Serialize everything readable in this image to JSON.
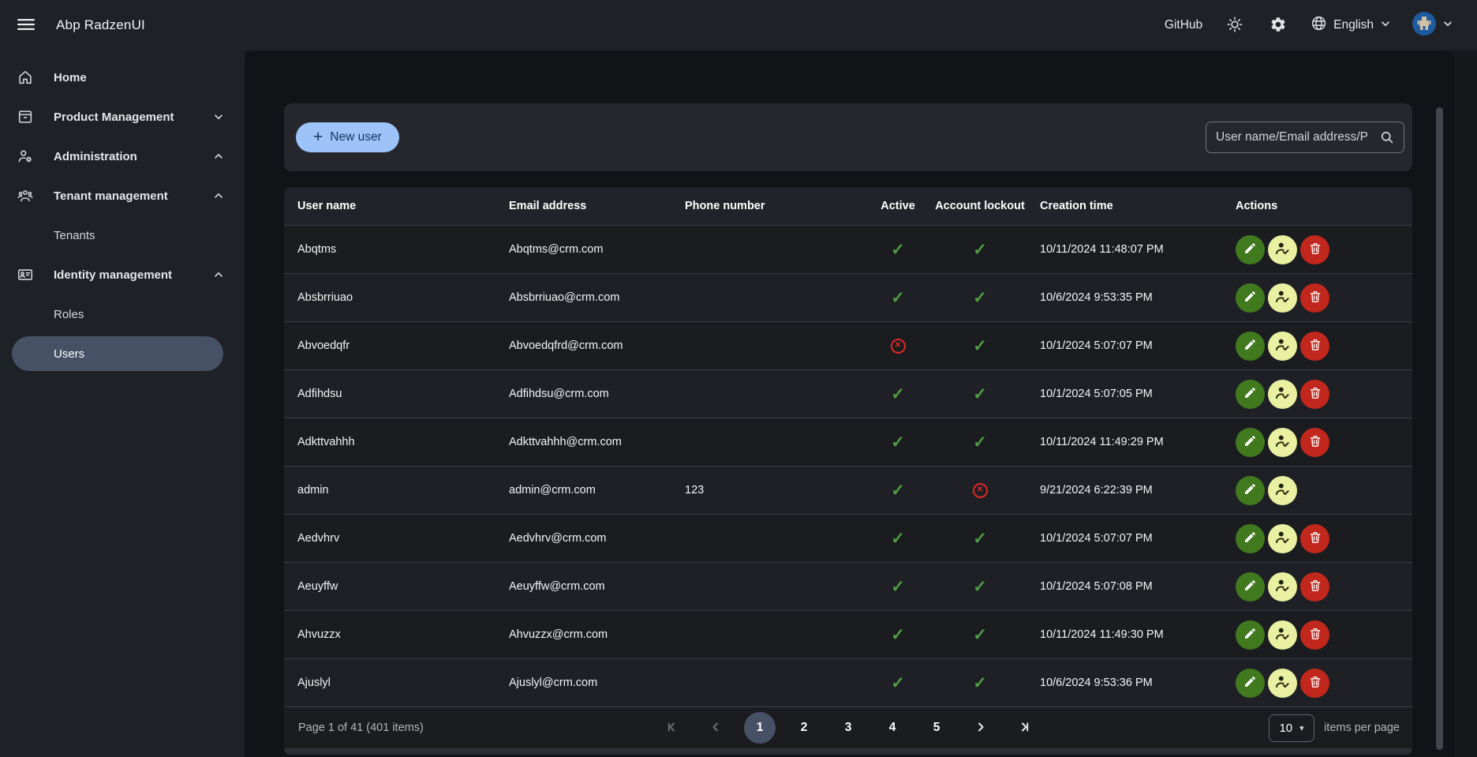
{
  "topbar": {
    "title": "Abp RadzenUI",
    "github": "GitHub",
    "language": "English",
    "menu_icon": "hamburger-icon",
    "theme_icon": "sun-icon",
    "settings_icon": "gear-icon",
    "language_icon": "globe-icon",
    "avatar_icon": "robot-avatar",
    "dropdown_icon": "chevron-down-icon"
  },
  "sidebar": {
    "items": [
      {
        "label": "Home",
        "icon": "home",
        "sub": false,
        "selected": false,
        "chevron": null
      },
      {
        "label": "Product Management",
        "icon": "box",
        "sub": false,
        "selected": false,
        "chevron": "down"
      },
      {
        "label": "Administration",
        "icon": "person-gear",
        "sub": false,
        "selected": false,
        "chevron": "up"
      },
      {
        "label": "Tenant management",
        "icon": "groups",
        "sub": false,
        "selected": false,
        "chevron": "up"
      },
      {
        "label": "Tenants",
        "icon": null,
        "sub": true,
        "selected": false,
        "chevron": null
      },
      {
        "label": "Identity management",
        "icon": "id-card",
        "sub": false,
        "selected": false,
        "chevron": "up"
      },
      {
        "label": "Roles",
        "icon": null,
        "sub": true,
        "selected": false,
        "chevron": null
      },
      {
        "label": "Users",
        "icon": null,
        "sub": true,
        "selected": true,
        "chevron": null
      }
    ]
  },
  "toolbar": {
    "new_user_label": "New user",
    "search_placeholder": "User name/Email address/P",
    "search_icon": "search-icon"
  },
  "table": {
    "columns": [
      "User name",
      "Email address",
      "Phone number",
      "Active",
      "Account lockout",
      "Creation time",
      "Actions"
    ],
    "status_icons": {
      "true": "check-icon",
      "false": "cancel-icon"
    },
    "action_icons": [
      "edit-icon",
      "user-check-icon",
      "trash-icon"
    ],
    "rows": [
      {
        "user_name": "Abqtms",
        "email": "Abqtms@crm.com",
        "phone": "",
        "active": true,
        "lockout": true,
        "creation_time": "10/11/2024 11:48:07 PM",
        "deletable": true
      },
      {
        "user_name": "Absbrriuao",
        "email": "Absbrriuao@crm.com",
        "phone": "",
        "active": true,
        "lockout": true,
        "creation_time": "10/6/2024 9:53:35 PM",
        "deletable": true
      },
      {
        "user_name": "Abvoedqfr",
        "email": "Abvoedqfrd@crm.com",
        "phone": "",
        "active": false,
        "lockout": true,
        "creation_time": "10/1/2024 5:07:07 PM",
        "deletable": true
      },
      {
        "user_name": "Adfihdsu",
        "email": "Adfihdsu@crm.com",
        "phone": "",
        "active": true,
        "lockout": true,
        "creation_time": "10/1/2024 5:07:05 PM",
        "deletable": true
      },
      {
        "user_name": "Adkttvahhh",
        "email": "Adkttvahhh@crm.com",
        "phone": "",
        "active": true,
        "lockout": true,
        "creation_time": "10/11/2024 11:49:29 PM",
        "deletable": true
      },
      {
        "user_name": "admin",
        "email": "admin@crm.com",
        "phone": "123",
        "active": true,
        "lockout": false,
        "creation_time": "9/21/2024 6:22:39 PM",
        "deletable": false
      },
      {
        "user_name": "Aedvhrv",
        "email": "Aedvhrv@crm.com",
        "phone": "",
        "active": true,
        "lockout": true,
        "creation_time": "10/1/2024 5:07:07 PM",
        "deletable": true
      },
      {
        "user_name": "Aeuyffw",
        "email": "Aeuyffw@crm.com",
        "phone": "",
        "active": true,
        "lockout": true,
        "creation_time": "10/1/2024 5:07:08 PM",
        "deletable": true
      },
      {
        "user_name": "Ahvuzzx",
        "email": "Ahvuzzx@crm.com",
        "phone": "",
        "active": true,
        "lockout": true,
        "creation_time": "10/11/2024 11:49:30 PM",
        "deletable": true
      },
      {
        "user_name": "Ajuslyl",
        "email": "Ajuslyl@crm.com",
        "phone": "",
        "active": true,
        "lockout": true,
        "creation_time": "10/6/2024 9:53:36 PM",
        "deletable": true
      }
    ]
  },
  "pagination": {
    "summary": "Page 1 of 41 (401 items)",
    "pages": [
      "1",
      "2",
      "3",
      "4",
      "5"
    ],
    "current_page": "1",
    "page_size": "10",
    "items_per_page_label": "items per page"
  },
  "colors": {
    "accent": "#9dc3f9",
    "success": "#4f9e42",
    "danger": "#e12626",
    "selected_pill": "#475166",
    "edit_button": "#41791f",
    "permissions_button": "#e9f0a2",
    "delete_button": "#c1271c"
  }
}
